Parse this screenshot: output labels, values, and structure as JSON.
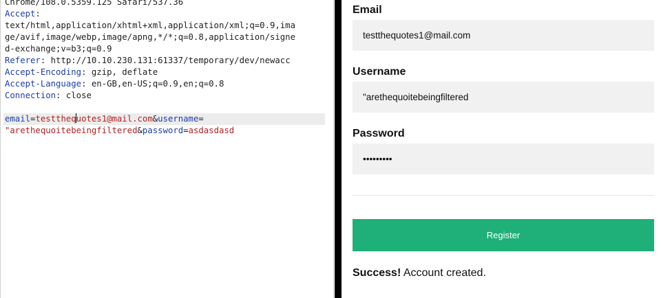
{
  "request": {
    "ua_tail": "Chrome/108.0.5359.125 Safari/537.36",
    "headers": [
      {
        "name": "Accept",
        "value_lines": [
          "text/html,application/xhtml+xml,application/xml;q=0.9,ima",
          "ge/avif,image/webp,image/apng,*/*;q=0.8,application/signe",
          "d-exchange;v=b3;q=0.9"
        ]
      },
      {
        "name": "Referer",
        "value": "http://10.10.230.131:61337/temporary/dev/newacc"
      },
      {
        "name": "Accept-Encoding",
        "value": "gzip, deflate"
      },
      {
        "name": "Accept-Language",
        "value": "en-GB,en-US;q=0.9,en;q=0.8"
      },
      {
        "name": "Connection",
        "value": "close"
      }
    ],
    "body": {
      "email_key": "email",
      "email_value_before_caret": "testtheq",
      "email_value_after_caret": "uotes1@mail.com",
      "username_key": "username",
      "username_value": "\"arethequoitebeingfiltered",
      "password_key": "password",
      "password_value": "asdasdasd"
    }
  },
  "form": {
    "email_label": "Email",
    "email_value": "testthequotes1@mail.com",
    "username_label": "Username",
    "username_value": "\"arethequoitebeingfiltered",
    "password_label": "Password",
    "password_value": "asdasdasd",
    "register_label": "Register",
    "success_strong": "Success!",
    "success_text": " Account created."
  },
  "colors": {
    "header_key": "#1c3ea7",
    "param_value": "#b22222",
    "button": "#1fb07a"
  }
}
